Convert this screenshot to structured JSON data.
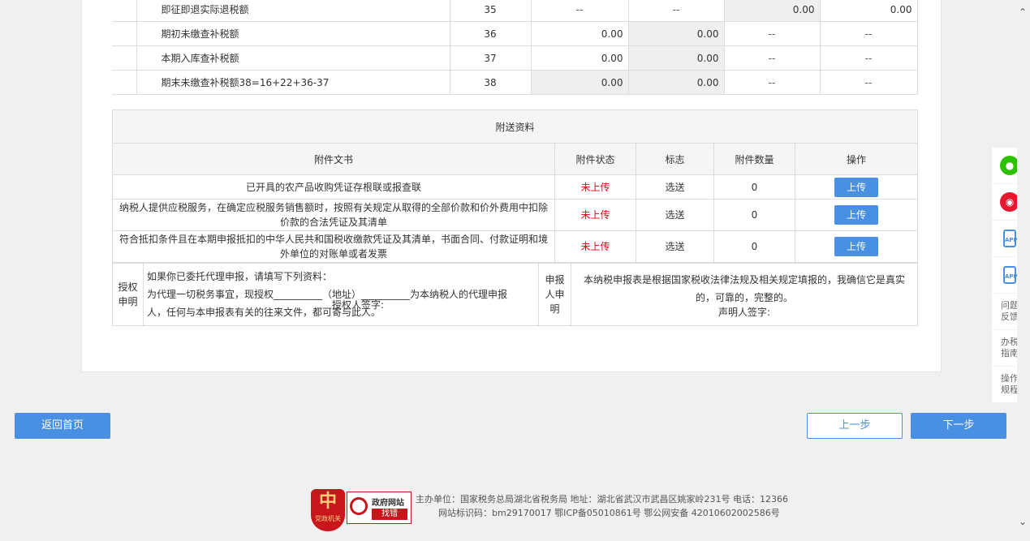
{
  "tax_rows": [
    {
      "label": "即征即退实际退税额",
      "num": "35",
      "c1": "--",
      "c2": "--",
      "c3": "0.00",
      "c4": "0.00"
    },
    {
      "label": "期初未缴查补税额",
      "num": "36",
      "c1": "0.00",
      "c2": "0.00",
      "c3": "--",
      "c4": "--"
    },
    {
      "label": "本期入库查补税额",
      "num": "37",
      "c1": "0.00",
      "c2": "0.00",
      "c3": "--",
      "c4": "--"
    },
    {
      "label": "期末未缴查补税额38=16+22+36-37",
      "num": "38",
      "c1": "0.00",
      "c2": "0.00",
      "c3": "--",
      "c4": "--"
    }
  ],
  "attachments": {
    "title": "附送资料",
    "headers": [
      "附件文书",
      "附件状态",
      "标志",
      "附件数量",
      "操作"
    ],
    "rows": [
      {
        "doc": "已开具的农产品收购凭证存根联或报查联",
        "status": "未上传",
        "flag": "选送",
        "count": "0",
        "action": "上传"
      },
      {
        "doc": "纳税人提供应税服务，在确定应税服务销售额时，按照有关规定从取得的全部价款和价外费用中扣除价款的合法凭证及其清单",
        "status": "未上传",
        "flag": "选送",
        "count": "0",
        "action": "上传"
      },
      {
        "doc": "符合抵扣条件且在本期申报抵扣的中华人民共和国税收缴款凭证及其清单，书面合同、付款证明和境外单位的对账单或者发票",
        "status": "未上传",
        "flag": "选送",
        "count": "0",
        "action": "上传"
      }
    ]
  },
  "declaration": {
    "auth_label": "授权申明",
    "auth_line1": "如果你已委托代理申报，请填写下列资料：",
    "auth_line2": "为代理一切税务事宜，现授权__________（地址）__________为本纳税人的代理申报",
    "auth_line3": "人，任何与本申报表有关的往来文件，都可寄与此人。",
    "auth_sign": "授权人签字:",
    "declarer_label": "申报人申明",
    "declarer_line1": "本纳税申报表是根据国家税收法律法规及相关规定填报的，我确信它是真实",
    "declarer_line2": "的，可靠的，完整的。",
    "declarer_sign": "声明人签字:"
  },
  "buttons": {
    "home": "返回首页",
    "prev": "上一步",
    "next": "下一步"
  },
  "side_panel": [
    {
      "icon": "wechat-icon",
      "label": ""
    },
    {
      "icon": "weibo-icon",
      "label": ""
    },
    {
      "icon": "app-icon",
      "label": ""
    },
    {
      "icon": "app-icon",
      "label": ""
    },
    {
      "icon": "",
      "label": "问题反馈"
    },
    {
      "icon": "",
      "label": "办税指南"
    },
    {
      "icon": "",
      "label": "操作规程"
    }
  ],
  "footer": {
    "line1": "主办单位：国家税务总局湖北省税务局   地址：湖北省武汉市武昌区姚家岭231号  电话：12366",
    "line2": "网站标识码：bm29170017   鄂ICP备05010861号   鄂公网安备 42010602002586号",
    "badge_top": "政府网站",
    "badge_bottom": "找错",
    "emblem_text": "党政机关"
  },
  "colors": {
    "accent": "#4a90e2",
    "error": "#e60012",
    "wechat": "#2dc100",
    "weibo": "#e6162d"
  }
}
